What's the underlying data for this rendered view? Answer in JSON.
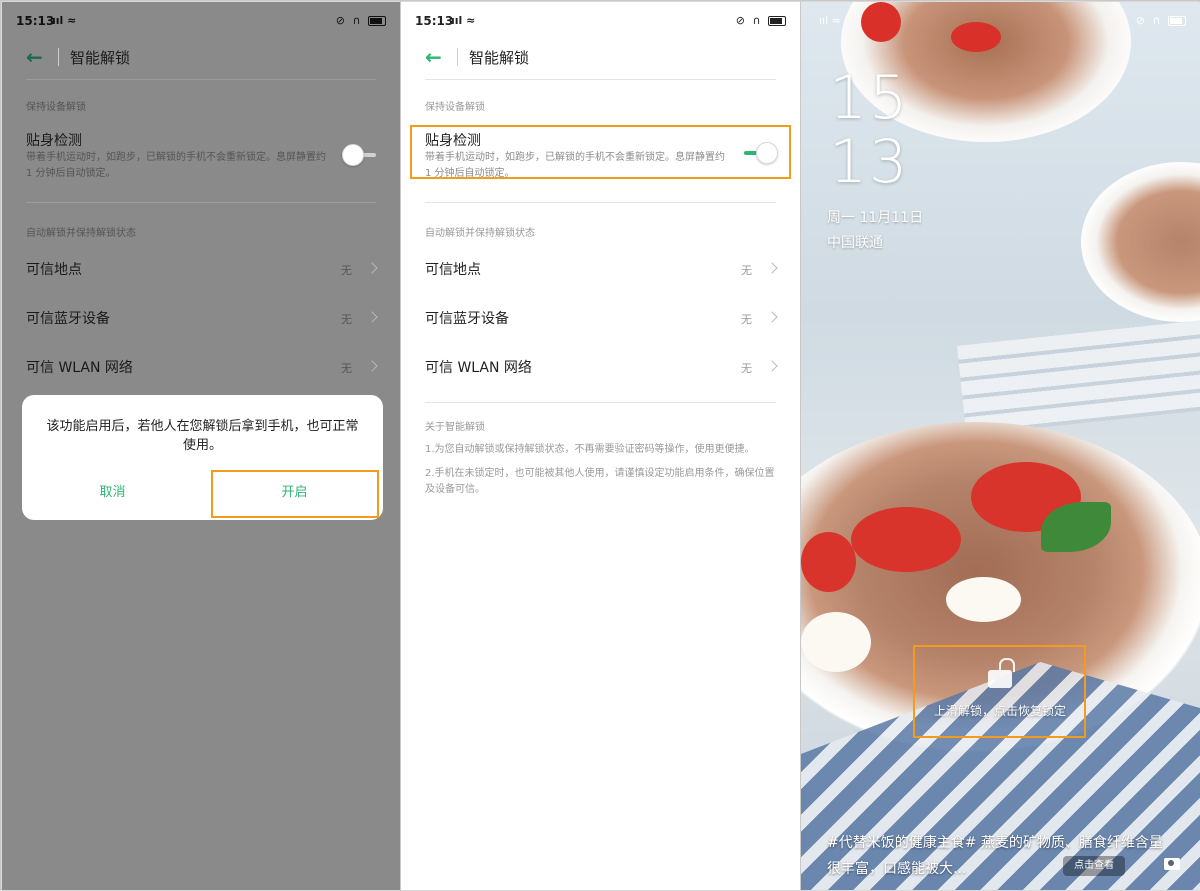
{
  "status_bar": {
    "time": "15:13",
    "signal": "ııl",
    "wifi": "≈",
    "icons": "⊘ ∩"
  },
  "header": {
    "title": "智能解锁"
  },
  "section1": {
    "label": "保持设备解锁"
  },
  "body_detection": {
    "title": "贴身检测",
    "desc": "带着手机运动时，如跑步，已解锁的手机不会重新锁定。息屏静置约 1 分钟后自动锁定。"
  },
  "section2": {
    "label": "自动解锁并保持解锁状态"
  },
  "rows": [
    {
      "title": "可信地点",
      "value": "无"
    },
    {
      "title": "可信蓝牙设备",
      "value": "无"
    },
    {
      "title": "可信 WLAN 网络",
      "value": "无"
    }
  ],
  "about": {
    "label": "关于智能解锁",
    "p1": "1.为您自动解锁或保持解锁状态，不再需要验证密码等操作，使用更便捷。",
    "p2": "2.手机在未锁定时，也可能被其他人使用，请谨慎设定功能启用条件，确保位置及设备可信。"
  },
  "dialog": {
    "message": "该功能启用后，若他人在您解锁后拿到手机，也可正常使用。",
    "cancel": "取消",
    "confirm": "开启"
  },
  "lockscreen": {
    "hour": "15",
    "minute": "13",
    "date": "周一 11月11日",
    "carrier": "中国联通",
    "unlock_hint": "上滑解锁，点击恢复锁定",
    "caption": "#代替米饭的健康主食# 燕麦的矿物质、膳食纤维含量很丰富，口感能被大...",
    "view_button": "点击查看"
  },
  "colors": {
    "accent": "#2db673",
    "highlight": "#f29b1d"
  }
}
